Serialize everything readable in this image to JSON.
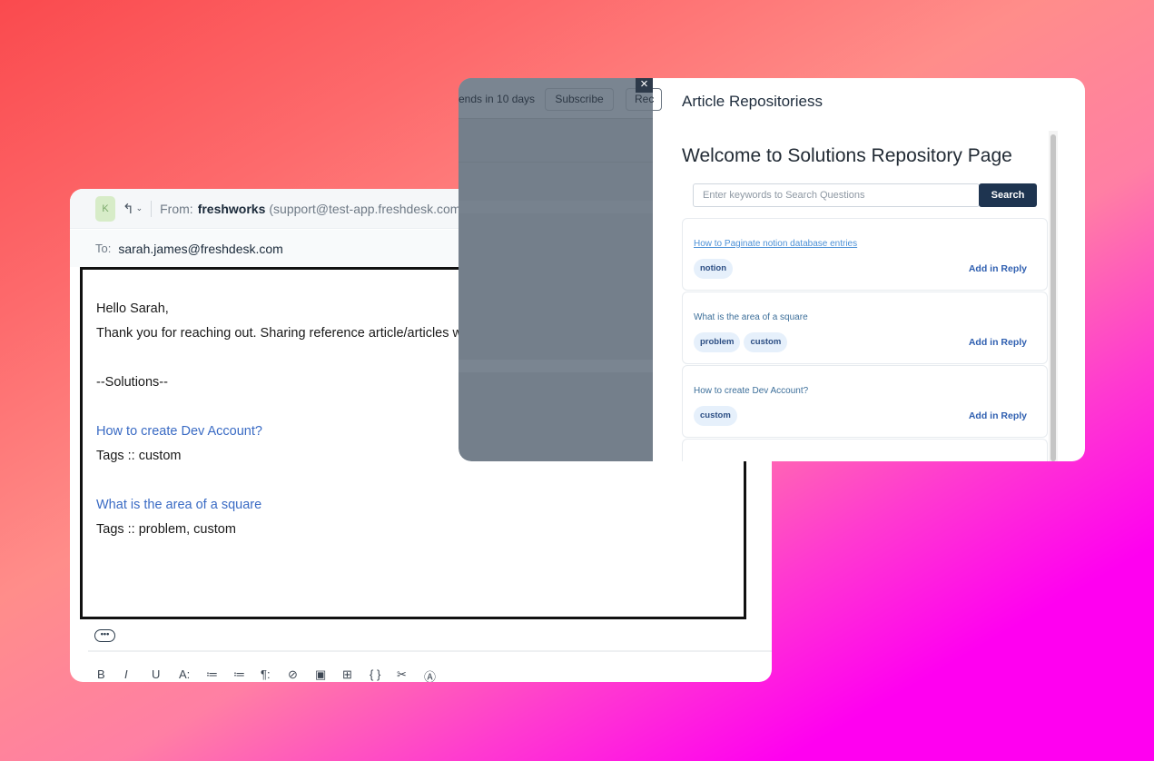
{
  "email": {
    "avatar_letter": "K",
    "reply_icon": "↰",
    "caret_icon": "⌄",
    "from_label": "From:",
    "from_name": "freshworks",
    "from_email": "(support@test-app.freshdesk.com)",
    "to_label": "To:",
    "to_email": "sarah.james@freshdesk.com",
    "body": {
      "greeting": "Hello Sarah,",
      "intro": "Thank you for reaching out. Sharing reference article/articles with you",
      "solutions_header": "--Solutions--",
      "articles": [
        {
          "title": "How to create Dev Account?",
          "tags_line": "Tags :: custom"
        },
        {
          "title": "What is the area of a square",
          "tags_line": "Tags :: problem, custom"
        }
      ]
    },
    "more_label": "•••",
    "toolbar": [
      "B",
      "I",
      "U",
      "A:",
      "≔",
      "≔",
      "¶:",
      "⊘",
      "▣",
      "⊞",
      "{ }",
      "✂",
      "Ⓐ"
    ]
  },
  "overlay": {
    "trial_text": "ends in 10 days",
    "subscribe_label": "Subscribe",
    "rec_label": "Rec",
    "close_icon": "×"
  },
  "panel": {
    "title": "Article Repositoriess",
    "welcome": "Welcome to Solutions Repository Page",
    "search_placeholder": "Enter keywords to Search Questions",
    "search_label": "Search",
    "add_reply_label": "Add in Reply",
    "articles": [
      {
        "title": "How to Paginate notion database entries",
        "tags": [
          "notion"
        ]
      },
      {
        "title": "What is the area of a square",
        "tags": [
          "problem",
          "custom"
        ]
      },
      {
        "title": "How to create Dev Account?",
        "tags": [
          "custom"
        ]
      }
    ]
  }
}
